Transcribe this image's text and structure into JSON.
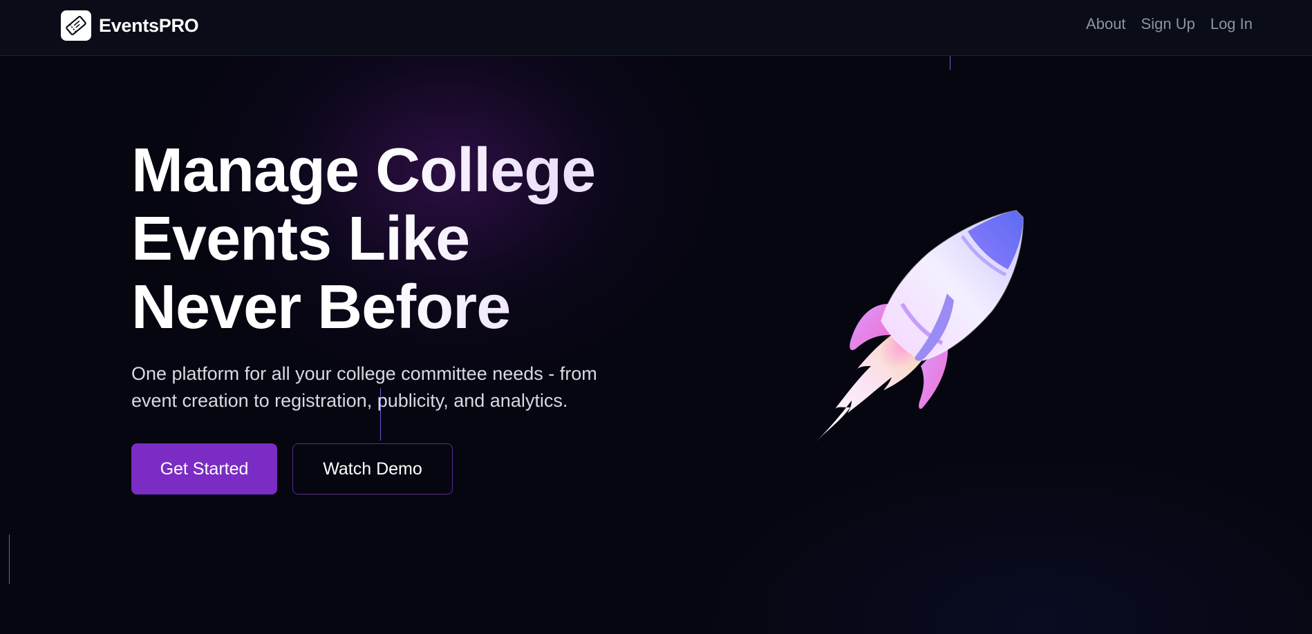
{
  "header": {
    "brand_name": "EventsPRO",
    "logo_icon": "ticket-icon",
    "nav": [
      {
        "label": "About"
      },
      {
        "label": "Sign Up"
      },
      {
        "label": "Log In"
      }
    ]
  },
  "hero": {
    "title_lines": [
      "Manage College",
      "Events Like",
      "Never Before"
    ],
    "subtitle_lines": [
      "One platform for all your college committee needs - from",
      "event creation to registration, publicity, and analytics."
    ],
    "primary_button": "Get Started",
    "secondary_button": "Watch Demo",
    "illustration_icon": "rocket-icon"
  },
  "colors": {
    "background": "#05060f",
    "navbar": "#0a0d18",
    "primary_button": "#7b2cc4",
    "secondary_border": "#5b2d8f",
    "nav_link": "#8c93a3",
    "accent_line": "#6d5bd6"
  }
}
